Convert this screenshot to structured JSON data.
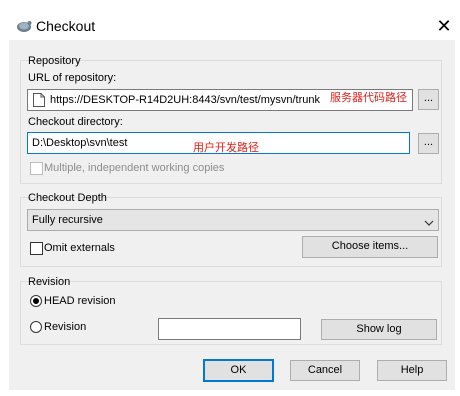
{
  "window": {
    "title": "Checkout",
    "close_glyph": "✕"
  },
  "repository": {
    "group_label": "Repository",
    "url_label": "URL of repository:",
    "url_value": "https://DESKTOP-R14D2UH:8443/svn/test/mysvn/trunk",
    "url_annotation": "服务器代码路径",
    "browse_label": "...",
    "dir_label": "Checkout directory:",
    "dir_value": "D:\\Desktop\\svn\\test",
    "dir_annotation": "用户开发路径",
    "dir_browse_label": "...",
    "multiple_label": "Multiple, independent working copies"
  },
  "depth": {
    "group_label": "Checkout Depth",
    "selected": "Fully recursive",
    "omit_label": "Omit externals",
    "choose_label": "Choose items..."
  },
  "revision": {
    "group_label": "Revision",
    "head_label": "HEAD revision",
    "rev_label": "Revision",
    "rev_value": "",
    "show_log_label": "Show log"
  },
  "footer": {
    "ok_label": "OK",
    "cancel_label": "Cancel",
    "help_label": "Help"
  },
  "colors": {
    "annotation": "#e0201a",
    "focus": "#0078d7"
  },
  "icons": [
    "tortoisesvn-app-icon",
    "close-icon",
    "file-icon",
    "chevron-down-icon"
  ]
}
